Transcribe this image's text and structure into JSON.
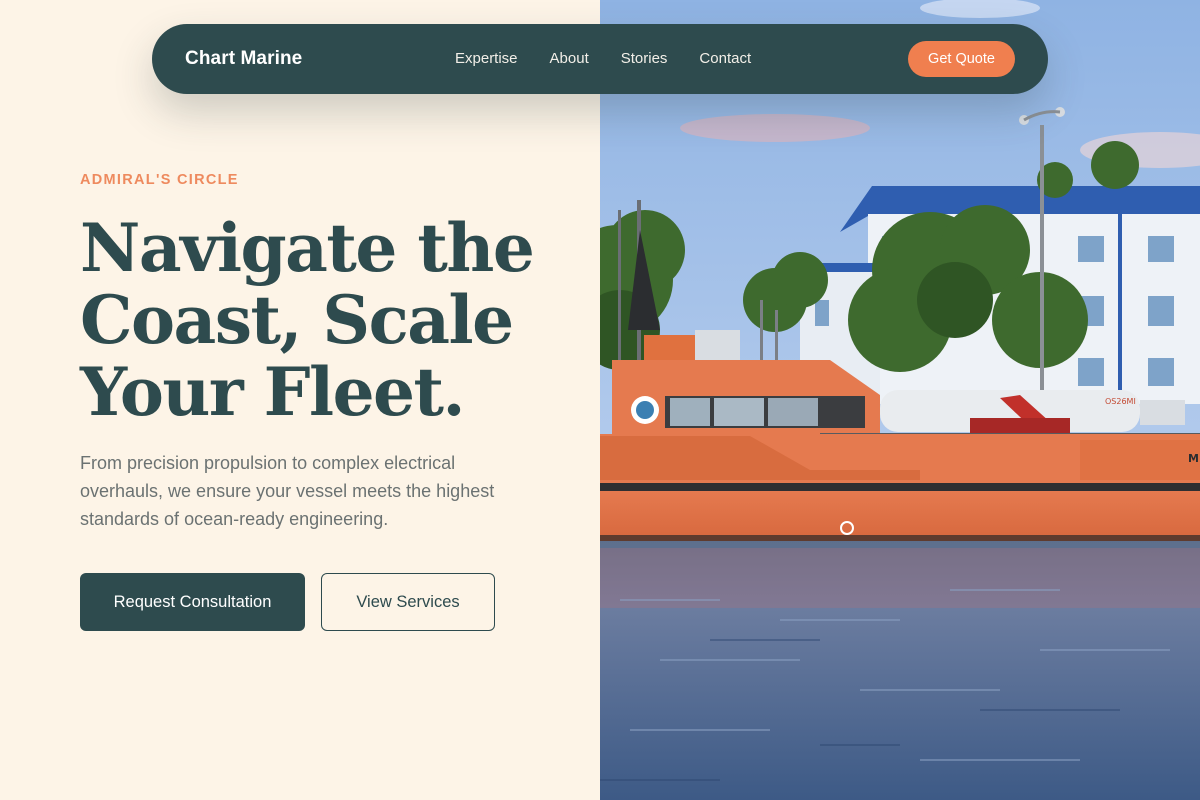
{
  "nav": {
    "brand": "Chart Marine",
    "links": [
      {
        "label": "Expertise"
      },
      {
        "label": "About"
      },
      {
        "label": "Stories"
      },
      {
        "label": "Contact"
      }
    ],
    "cta_label": "Get Quote"
  },
  "hero": {
    "eyebrow": "ADMIRAL'S CIRCLE",
    "headline_lines": [
      "Navigate the",
      "Coast, Scale",
      "Your Fleet."
    ],
    "lead": "From precision propulsion to complex electrical overhauls, we ensure your vessel meets the highest standards of ocean-ready engineering.",
    "primary_button": "Request Consultation",
    "secondary_button": "View Services"
  },
  "photo": {
    "subject": "orange-pilot-boat-photo",
    "hull_text": "OS26MI",
    "bow_text": "M"
  },
  "colors": {
    "brand_dark": "#2e4b4e",
    "accent": "#f07f4f",
    "background": "#fdf4e7",
    "eyebrow": "#ee8a5e"
  }
}
